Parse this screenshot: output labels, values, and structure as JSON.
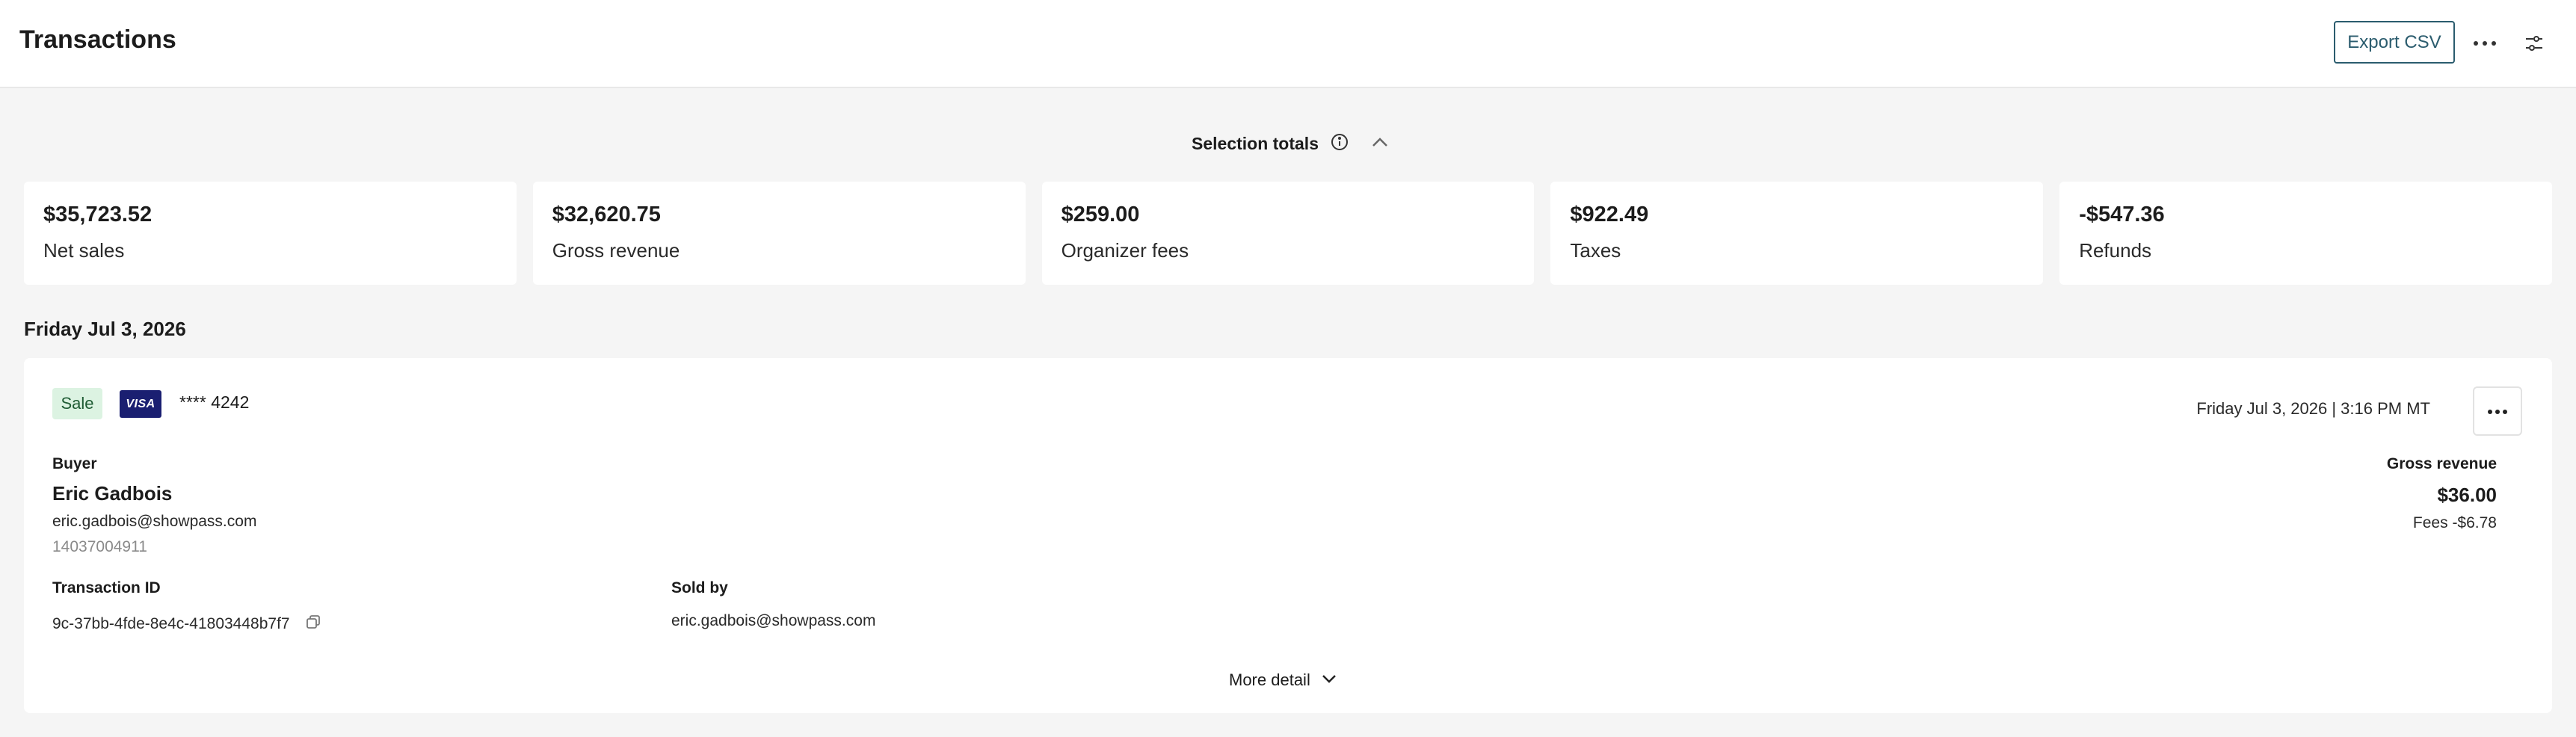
{
  "header": {
    "title": "Transactions",
    "export_label": "Export CSV",
    "more_icon": "more-horizontal-icon",
    "filter_icon": "filter-settings-icon"
  },
  "selection": {
    "label": "Selection totals",
    "info_icon": "info-icon",
    "collapse_icon": "chevron-up-icon"
  },
  "totals": [
    {
      "value": "$35,723.52",
      "label": "Net sales"
    },
    {
      "value": "$32,620.75",
      "label": "Gross revenue"
    },
    {
      "value": "$259.00",
      "label": "Organizer fees"
    },
    {
      "value": "$922.49",
      "label": "Taxes"
    },
    {
      "value": "-$547.36",
      "label": "Refunds"
    }
  ],
  "date_heading": "Friday Jul 3, 2026",
  "transaction": {
    "type_badge": "Sale",
    "card_brand": "VISA",
    "card_last4": "**** 4242",
    "datetime": "Friday Jul 3, 2026 | 3:16 PM MT",
    "buyer_label": "Buyer",
    "buyer_name": "Eric Gadbois",
    "buyer_email": "eric.gadbois@showpass.com",
    "buyer_phone": "14037004911",
    "gross_revenue_label": "Gross revenue",
    "gross_revenue_value": "$36.00",
    "fees": "Fees -$6.78",
    "transaction_id_label": "Transaction ID",
    "transaction_id": "9c-37bb-4fde-8e4c-41803448b7f7",
    "sold_by_label": "Sold by",
    "sold_by": "eric.gadbois@showpass.com",
    "more_detail_label": "More detail"
  },
  "colors": {
    "accent": "#2b5c6e",
    "sale_badge_bg": "#dcf3e2",
    "sale_badge_text": "#1f5c34",
    "visa_blue": "#1a1f71",
    "page_bg": "#f5f5f5"
  }
}
